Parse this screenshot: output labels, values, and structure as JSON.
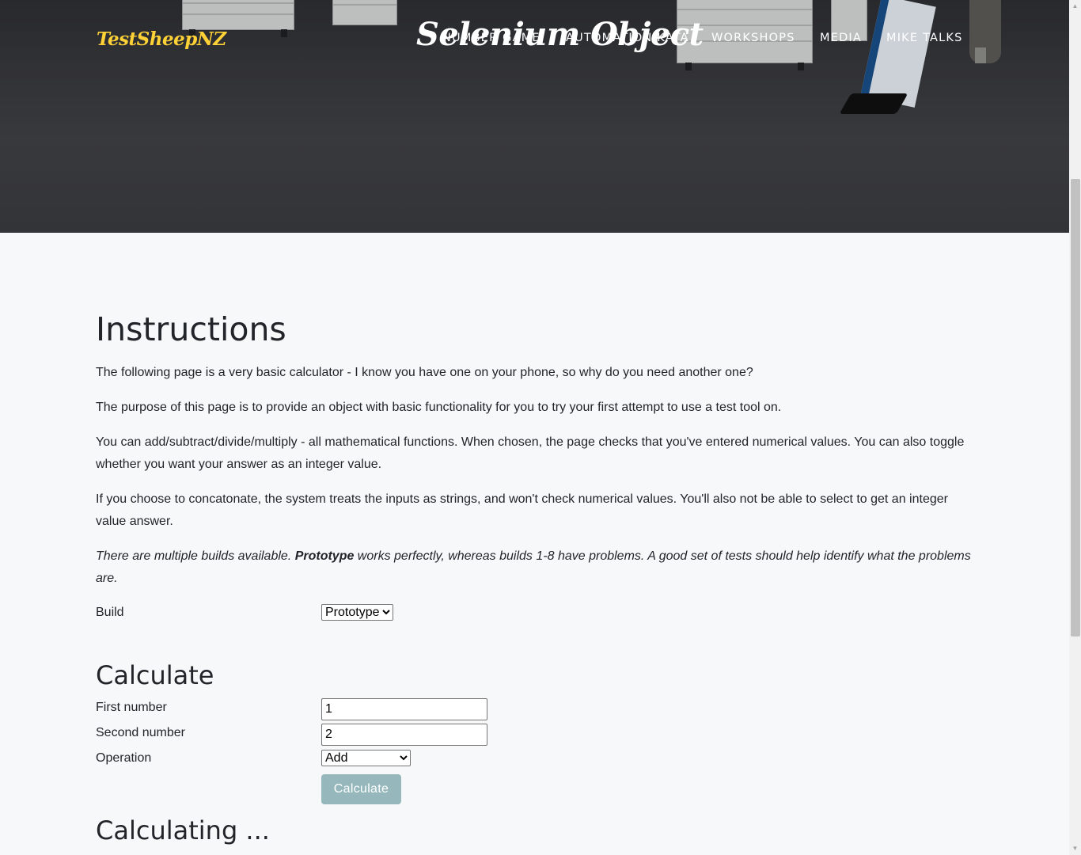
{
  "nav": {
    "brand": "TestSheepNZ",
    "items": [
      {
        "label": "NUMBER GAME"
      },
      {
        "label": "AUTOMATION KATA"
      },
      {
        "label": "WORKSHOPS"
      },
      {
        "label": "MEDIA"
      },
      {
        "label": "MIKE TALKS"
      }
    ]
  },
  "hero": {
    "title": "Selenium Object"
  },
  "instructions": {
    "heading": "Instructions",
    "paragraphs": [
      "The following page is a very basic calculator - I know you have one on your phone, so why do you need another one?",
      "The purpose of this page is to provide an object with basic functionality for you to try your first attempt to use a test tool on.",
      "You can add/subtract/divide/multiply - all mathematical functions. When chosen, the page checks that you've entered numerical values. You can also toggle whether you want your answer as an integer value.",
      "If you choose to concatonate, the system treats the inputs as strings, and won't check numerical values. You'll also not be able to select to get an integer value answer."
    ],
    "note_pre": "There are multiple builds available. ",
    "note_bold": "Prototype",
    "note_post": " works perfectly, whereas builds 1-8 have problems. A good set of tests should help identify what the problems are."
  },
  "build": {
    "label": "Build",
    "selected": "Prototype"
  },
  "calculate": {
    "heading": "Calculate",
    "first_label": "First number",
    "first_value": "1",
    "second_label": "Second number",
    "second_value": "2",
    "operation_label": "Operation",
    "operation_selected": "Add",
    "button_label": "Calculate"
  },
  "calculating": {
    "heading": "Calculating ..."
  }
}
